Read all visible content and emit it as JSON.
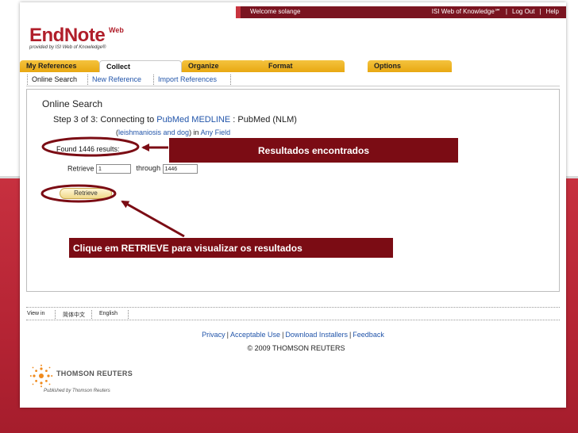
{
  "header": {
    "welcome": "Welcome solange",
    "links": [
      "ISI Web of Knowledge℠",
      "Log Out",
      "Help"
    ]
  },
  "logo": {
    "name": "EndNote",
    "superscript": "Web",
    "subtitle": "provided by ISI Web of Knowledge®"
  },
  "tabs": [
    "My References",
    "Collect",
    "Organize",
    "Format",
    "Options"
  ],
  "subnav": [
    "Online Search",
    "New Reference",
    "Import References"
  ],
  "main": {
    "title": "Online Search",
    "step_prefix": "Step 3 of 3: Connecting to ",
    "step_database": "PubMed MEDLINE",
    "step_suffix": " : PubMed (NLM)",
    "query_open": "(",
    "query_link": "leishmaniosis and dog",
    "query_close": ") in ",
    "query_field": "Any Field",
    "found": "Found 1446 results:",
    "retrieve_label": "Retrieve",
    "retrieve_from": "1",
    "through_label": "through",
    "retrieve_to": "1446",
    "retrieve_button": "Retrieve"
  },
  "language_bar": {
    "label": "View in",
    "chinese": "简体中文",
    "english": "English"
  },
  "footer": {
    "links": [
      "Privacy",
      "Acceptable Use",
      "Download Installers",
      "Feedback"
    ],
    "copyright": "© 2009 THOMSON REUTERS",
    "company": "THOMSON REUTERS",
    "published": "Published by Thomson Reuters"
  },
  "annotations": {
    "results_found": "Resultados encontrados",
    "click_retrieve": "Clique em RETRIEVE para visualizar os resultados"
  },
  "colors": {
    "brand_red": "#b01e2a",
    "annotation_fill": "#7b0c14",
    "tab_gold": "#f0b429",
    "link_blue": "#2255aa"
  }
}
